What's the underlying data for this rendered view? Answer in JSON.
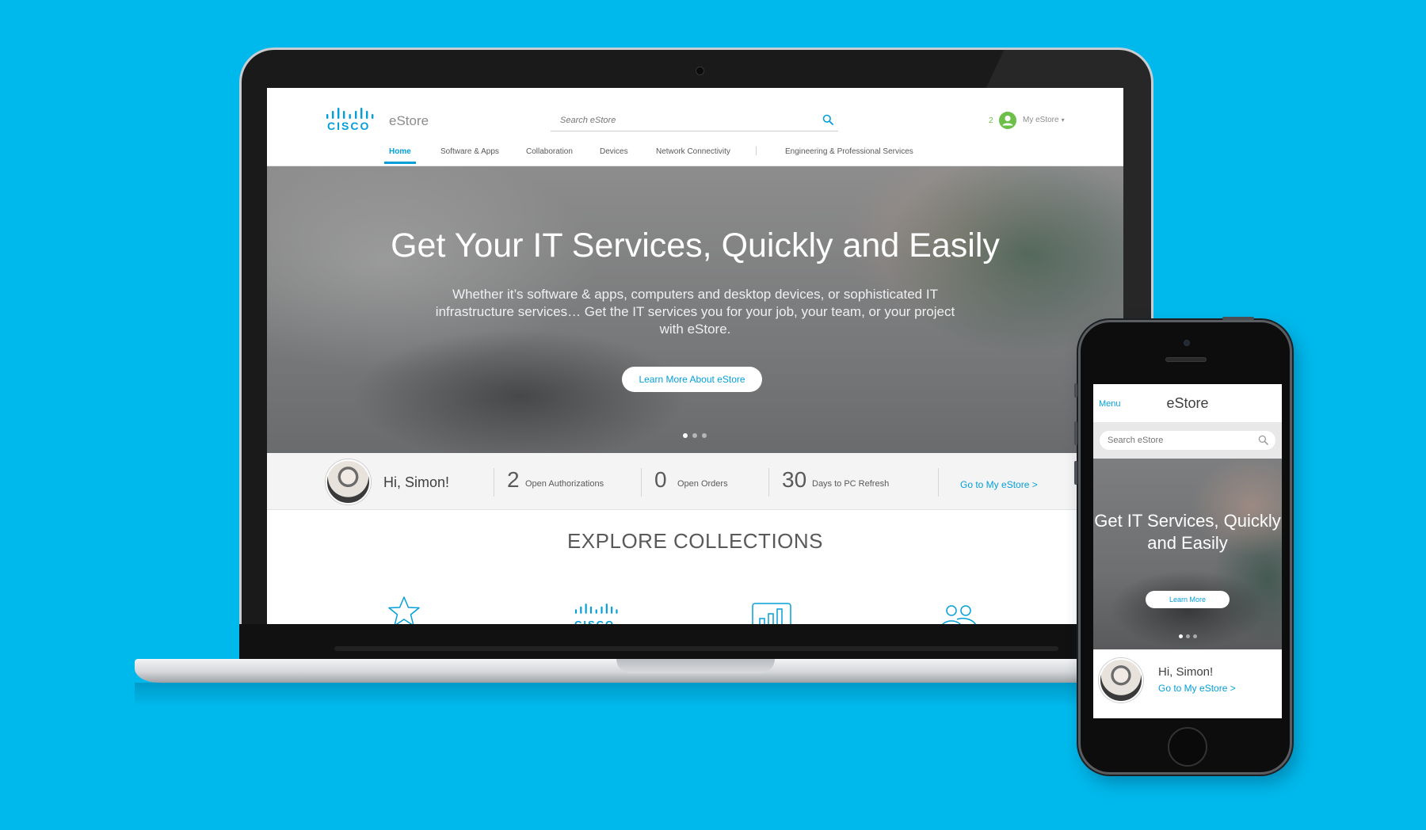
{
  "desktop": {
    "site_name": "eStore",
    "brand": "CISCO",
    "search": {
      "placeholder": "Search eStore"
    },
    "cart_count": "2",
    "account_label": "My eStore",
    "nav": [
      {
        "label": "Home",
        "active": true
      },
      {
        "label": "Software & Apps"
      },
      {
        "label": "Collaboration"
      },
      {
        "label": "Devices"
      },
      {
        "label": "Network Connectivity"
      },
      {
        "label": "Engineering & Professional Services"
      }
    ],
    "hero": {
      "title": "Get Your IT Services, Quickly and Easily",
      "body": "Whether it’s software & apps, computers and desktop devices, or sophisticated IT infrastructure services… Get the IT services you for your job, your team, or your project with eStore.",
      "cta": "Learn More About eStore",
      "slides": 3,
      "active_slide": 1
    },
    "stats": {
      "greeting": "Hi, Simon!",
      "items": [
        {
          "value": "2",
          "label": "Open Authorizations"
        },
        {
          "value": "0",
          "label": "Open Orders"
        },
        {
          "value": "30",
          "label": "Days to PC Refresh"
        }
      ],
      "link": "Go to My eStore >"
    },
    "explore": {
      "title": "EXPLORE COLLECTIONS",
      "collections": [
        "star-icon",
        "cisco-logo-icon",
        "chart-icon",
        "people-icon"
      ]
    }
  },
  "mobile": {
    "menu_label": "Menu",
    "title": "eStore",
    "search_placeholder": "Search eStore",
    "hero_title": "Get IT Services, Quickly and Easily",
    "cta": "Learn More",
    "slides": 3,
    "active_slide": 1,
    "greeting": "Hi, Simon!",
    "link": "Go to My eStore >"
  },
  "colors": {
    "background": "#00b9ec",
    "accent": "#049fd9",
    "cart_badge": "#6cc04a"
  }
}
